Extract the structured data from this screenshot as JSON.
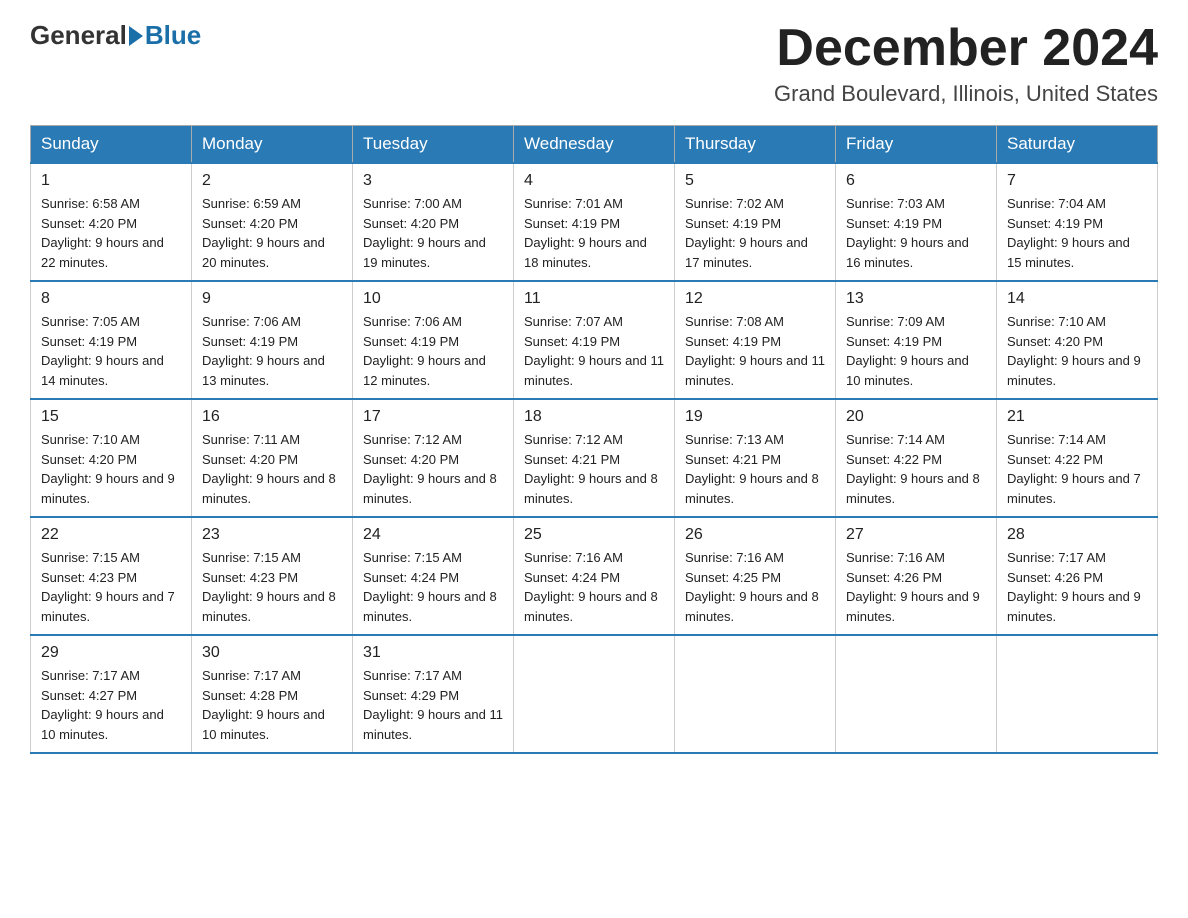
{
  "header": {
    "logo_general": "General",
    "logo_blue": "Blue",
    "month_title": "December 2024",
    "location": "Grand Boulevard, Illinois, United States"
  },
  "days_of_week": [
    "Sunday",
    "Monday",
    "Tuesday",
    "Wednesday",
    "Thursday",
    "Friday",
    "Saturday"
  ],
  "weeks": [
    [
      {
        "day": "1",
        "sunrise": "6:58 AM",
        "sunset": "4:20 PM",
        "daylight": "9 hours and 22 minutes."
      },
      {
        "day": "2",
        "sunrise": "6:59 AM",
        "sunset": "4:20 PM",
        "daylight": "9 hours and 20 minutes."
      },
      {
        "day": "3",
        "sunrise": "7:00 AM",
        "sunset": "4:20 PM",
        "daylight": "9 hours and 19 minutes."
      },
      {
        "day": "4",
        "sunrise": "7:01 AM",
        "sunset": "4:19 PM",
        "daylight": "9 hours and 18 minutes."
      },
      {
        "day": "5",
        "sunrise": "7:02 AM",
        "sunset": "4:19 PM",
        "daylight": "9 hours and 17 minutes."
      },
      {
        "day": "6",
        "sunrise": "7:03 AM",
        "sunset": "4:19 PM",
        "daylight": "9 hours and 16 minutes."
      },
      {
        "day": "7",
        "sunrise": "7:04 AM",
        "sunset": "4:19 PM",
        "daylight": "9 hours and 15 minutes."
      }
    ],
    [
      {
        "day": "8",
        "sunrise": "7:05 AM",
        "sunset": "4:19 PM",
        "daylight": "9 hours and 14 minutes."
      },
      {
        "day": "9",
        "sunrise": "7:06 AM",
        "sunset": "4:19 PM",
        "daylight": "9 hours and 13 minutes."
      },
      {
        "day": "10",
        "sunrise": "7:06 AM",
        "sunset": "4:19 PM",
        "daylight": "9 hours and 12 minutes."
      },
      {
        "day": "11",
        "sunrise": "7:07 AM",
        "sunset": "4:19 PM",
        "daylight": "9 hours and 11 minutes."
      },
      {
        "day": "12",
        "sunrise": "7:08 AM",
        "sunset": "4:19 PM",
        "daylight": "9 hours and 11 minutes."
      },
      {
        "day": "13",
        "sunrise": "7:09 AM",
        "sunset": "4:19 PM",
        "daylight": "9 hours and 10 minutes."
      },
      {
        "day": "14",
        "sunrise": "7:10 AM",
        "sunset": "4:20 PM",
        "daylight": "9 hours and 9 minutes."
      }
    ],
    [
      {
        "day": "15",
        "sunrise": "7:10 AM",
        "sunset": "4:20 PM",
        "daylight": "9 hours and 9 minutes."
      },
      {
        "day": "16",
        "sunrise": "7:11 AM",
        "sunset": "4:20 PM",
        "daylight": "9 hours and 8 minutes."
      },
      {
        "day": "17",
        "sunrise": "7:12 AM",
        "sunset": "4:20 PM",
        "daylight": "9 hours and 8 minutes."
      },
      {
        "day": "18",
        "sunrise": "7:12 AM",
        "sunset": "4:21 PM",
        "daylight": "9 hours and 8 minutes."
      },
      {
        "day": "19",
        "sunrise": "7:13 AM",
        "sunset": "4:21 PM",
        "daylight": "9 hours and 8 minutes."
      },
      {
        "day": "20",
        "sunrise": "7:14 AM",
        "sunset": "4:22 PM",
        "daylight": "9 hours and 8 minutes."
      },
      {
        "day": "21",
        "sunrise": "7:14 AM",
        "sunset": "4:22 PM",
        "daylight": "9 hours and 7 minutes."
      }
    ],
    [
      {
        "day": "22",
        "sunrise": "7:15 AM",
        "sunset": "4:23 PM",
        "daylight": "9 hours and 7 minutes."
      },
      {
        "day": "23",
        "sunrise": "7:15 AM",
        "sunset": "4:23 PM",
        "daylight": "9 hours and 8 minutes."
      },
      {
        "day": "24",
        "sunrise": "7:15 AM",
        "sunset": "4:24 PM",
        "daylight": "9 hours and 8 minutes."
      },
      {
        "day": "25",
        "sunrise": "7:16 AM",
        "sunset": "4:24 PM",
        "daylight": "9 hours and 8 minutes."
      },
      {
        "day": "26",
        "sunrise": "7:16 AM",
        "sunset": "4:25 PM",
        "daylight": "9 hours and 8 minutes."
      },
      {
        "day": "27",
        "sunrise": "7:16 AM",
        "sunset": "4:26 PM",
        "daylight": "9 hours and 9 minutes."
      },
      {
        "day": "28",
        "sunrise": "7:17 AM",
        "sunset": "4:26 PM",
        "daylight": "9 hours and 9 minutes."
      }
    ],
    [
      {
        "day": "29",
        "sunrise": "7:17 AM",
        "sunset": "4:27 PM",
        "daylight": "9 hours and 10 minutes."
      },
      {
        "day": "30",
        "sunrise": "7:17 AM",
        "sunset": "4:28 PM",
        "daylight": "9 hours and 10 minutes."
      },
      {
        "day": "31",
        "sunrise": "7:17 AM",
        "sunset": "4:29 PM",
        "daylight": "9 hours and 11 minutes."
      },
      null,
      null,
      null,
      null
    ]
  ]
}
